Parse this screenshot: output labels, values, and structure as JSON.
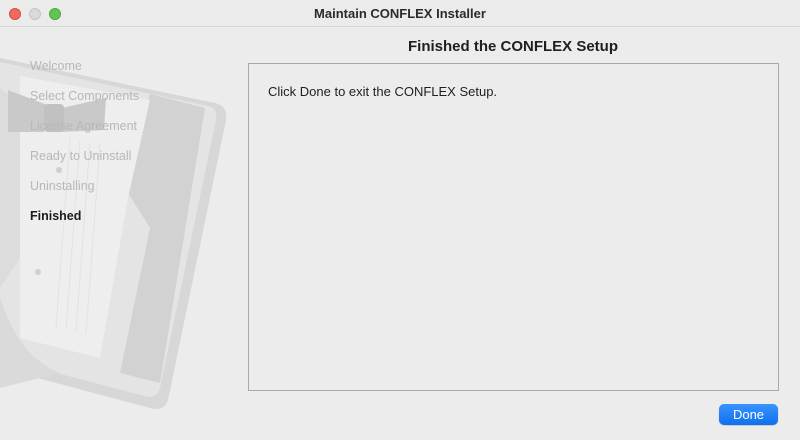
{
  "window": {
    "title": "Maintain CONFLEX Installer"
  },
  "sidebar": {
    "steps": [
      {
        "label": "Welcome",
        "state": "done"
      },
      {
        "label": "Select Components",
        "state": "done"
      },
      {
        "label": "License Agreement",
        "state": "done"
      },
      {
        "label": "Ready to Uninstall",
        "state": "done"
      },
      {
        "label": "Uninstalling",
        "state": "done"
      },
      {
        "label": "Finished",
        "state": "active"
      }
    ]
  },
  "main": {
    "heading": "Finished the CONFLEX Setup",
    "message": "Click Done to exit the CONFLEX Setup."
  },
  "footer": {
    "done_label": "Done"
  },
  "colors": {
    "accent": "#1a7cf7",
    "close": "#ed6a5e",
    "maximize": "#61c554"
  }
}
